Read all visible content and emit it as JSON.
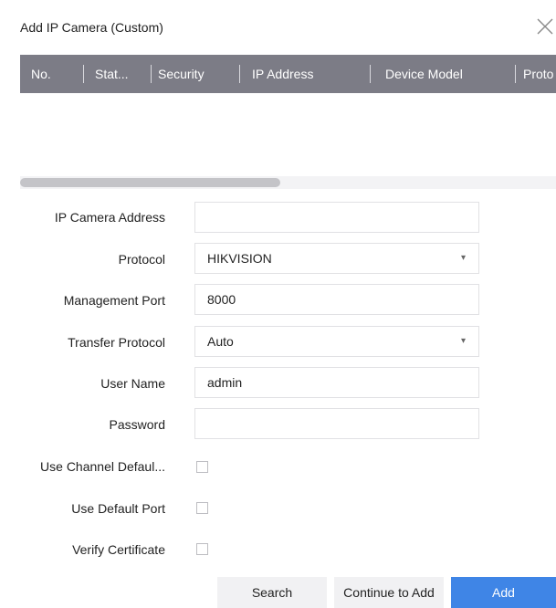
{
  "dialog": {
    "title": "Add IP Camera (Custom)",
    "close_icon": "close-icon"
  },
  "table": {
    "columns": [
      "No.",
      "Stat...",
      "Security",
      "IP Address",
      "Device Model",
      "Proto"
    ]
  },
  "form": {
    "ip_camera_address": {
      "label": "IP Camera Address",
      "value": ""
    },
    "protocol": {
      "label": "Protocol",
      "value": "HIKVISION"
    },
    "management_port": {
      "label": "Management Port",
      "value": "8000"
    },
    "transfer_protocol": {
      "label": "Transfer Protocol",
      "value": "Auto"
    },
    "user_name": {
      "label": "User Name",
      "value": "admin"
    },
    "password": {
      "label": "Password",
      "value": ""
    },
    "use_channel_default": {
      "label": "Use Channel Defaul...",
      "checked": false
    },
    "use_default_port": {
      "label": "Use Default Port",
      "checked": false
    },
    "verify_certificate": {
      "label": "Verify Certificate",
      "checked": false
    }
  },
  "buttons": {
    "search": "Search",
    "continue": "Continue to Add",
    "add": "Add"
  },
  "colors": {
    "header_bg": "#7c7c86",
    "primary": "#3f85e6",
    "button_bg": "#f1f1f3"
  }
}
